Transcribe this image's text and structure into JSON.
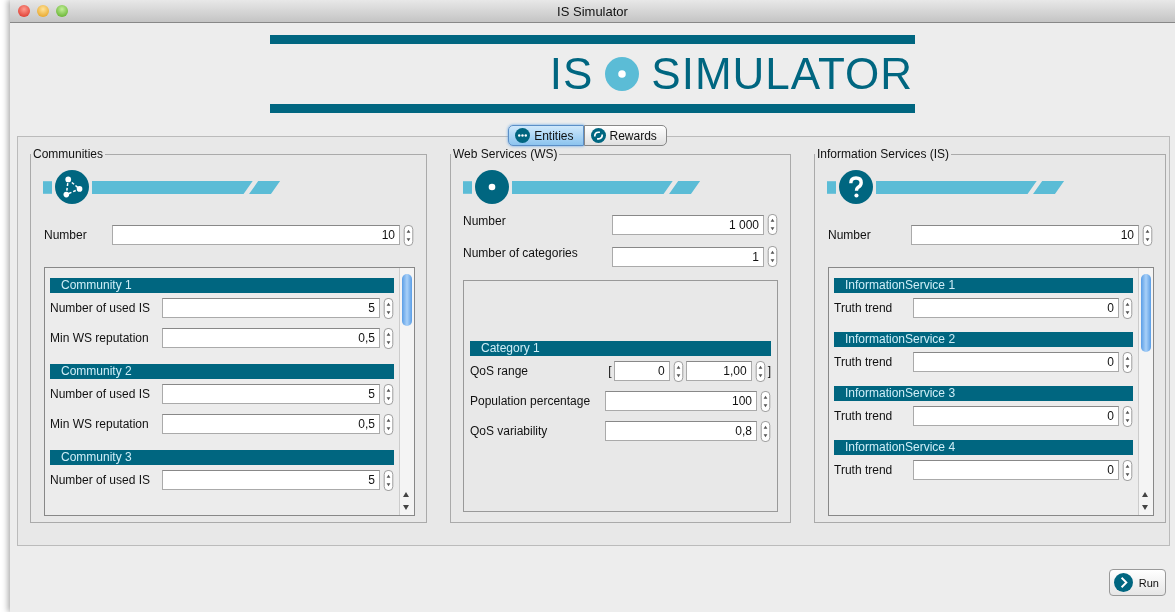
{
  "window": {
    "title": "IS Simulator"
  },
  "logo": {
    "left": "IS",
    "right": "SIMULATOR"
  },
  "tabs": [
    {
      "label": "Entities",
      "kind": "dots",
      "selected": true
    },
    {
      "label": "Rewards",
      "kind": "cycle",
      "selected": false
    }
  ],
  "communities": {
    "title": "Communities",
    "number_label": "Number",
    "number": "10",
    "items": [
      {
        "title": "Community 1",
        "fields": [
          {
            "label": "Number of used IS",
            "value": "5"
          },
          {
            "label": "Min WS reputation",
            "value": "0,5"
          }
        ]
      },
      {
        "title": "Community 2",
        "fields": [
          {
            "label": "Number of used IS",
            "value": "5"
          },
          {
            "label": "Min WS reputation",
            "value": "0,5"
          }
        ]
      },
      {
        "title": "Community 3",
        "fields": [
          {
            "label": "Number of used IS",
            "value": "5"
          }
        ]
      }
    ]
  },
  "web_services": {
    "title": "Web Services (WS)",
    "fields": [
      {
        "label": "Number",
        "value": "1 000"
      },
      {
        "label": "Number of categories",
        "value": "1"
      }
    ],
    "category": {
      "title": "Category 1",
      "qos_range": {
        "label": "QoS range",
        "open": "[",
        "min": "0",
        "max": "1,00",
        "close": "]"
      },
      "fields": [
        {
          "label": "Population percentage",
          "value": "100"
        },
        {
          "label": "QoS variability",
          "value": "0,8"
        }
      ]
    }
  },
  "information_services": {
    "title": "Information Services (IS)",
    "number_label": "Number",
    "number": "10",
    "items": [
      {
        "title": "InformationService 1",
        "fields": [
          {
            "label": "Truth trend",
            "value": "0"
          }
        ]
      },
      {
        "title": "InformationService 2",
        "fields": [
          {
            "label": "Truth trend",
            "value": "0"
          }
        ]
      },
      {
        "title": "InformationService 3",
        "fields": [
          {
            "label": "Truth trend",
            "value": "0"
          }
        ]
      },
      {
        "title": "InformationService 4",
        "fields": [
          {
            "label": "Truth trend",
            "value": "0"
          }
        ]
      }
    ]
  },
  "run_button": "Run"
}
